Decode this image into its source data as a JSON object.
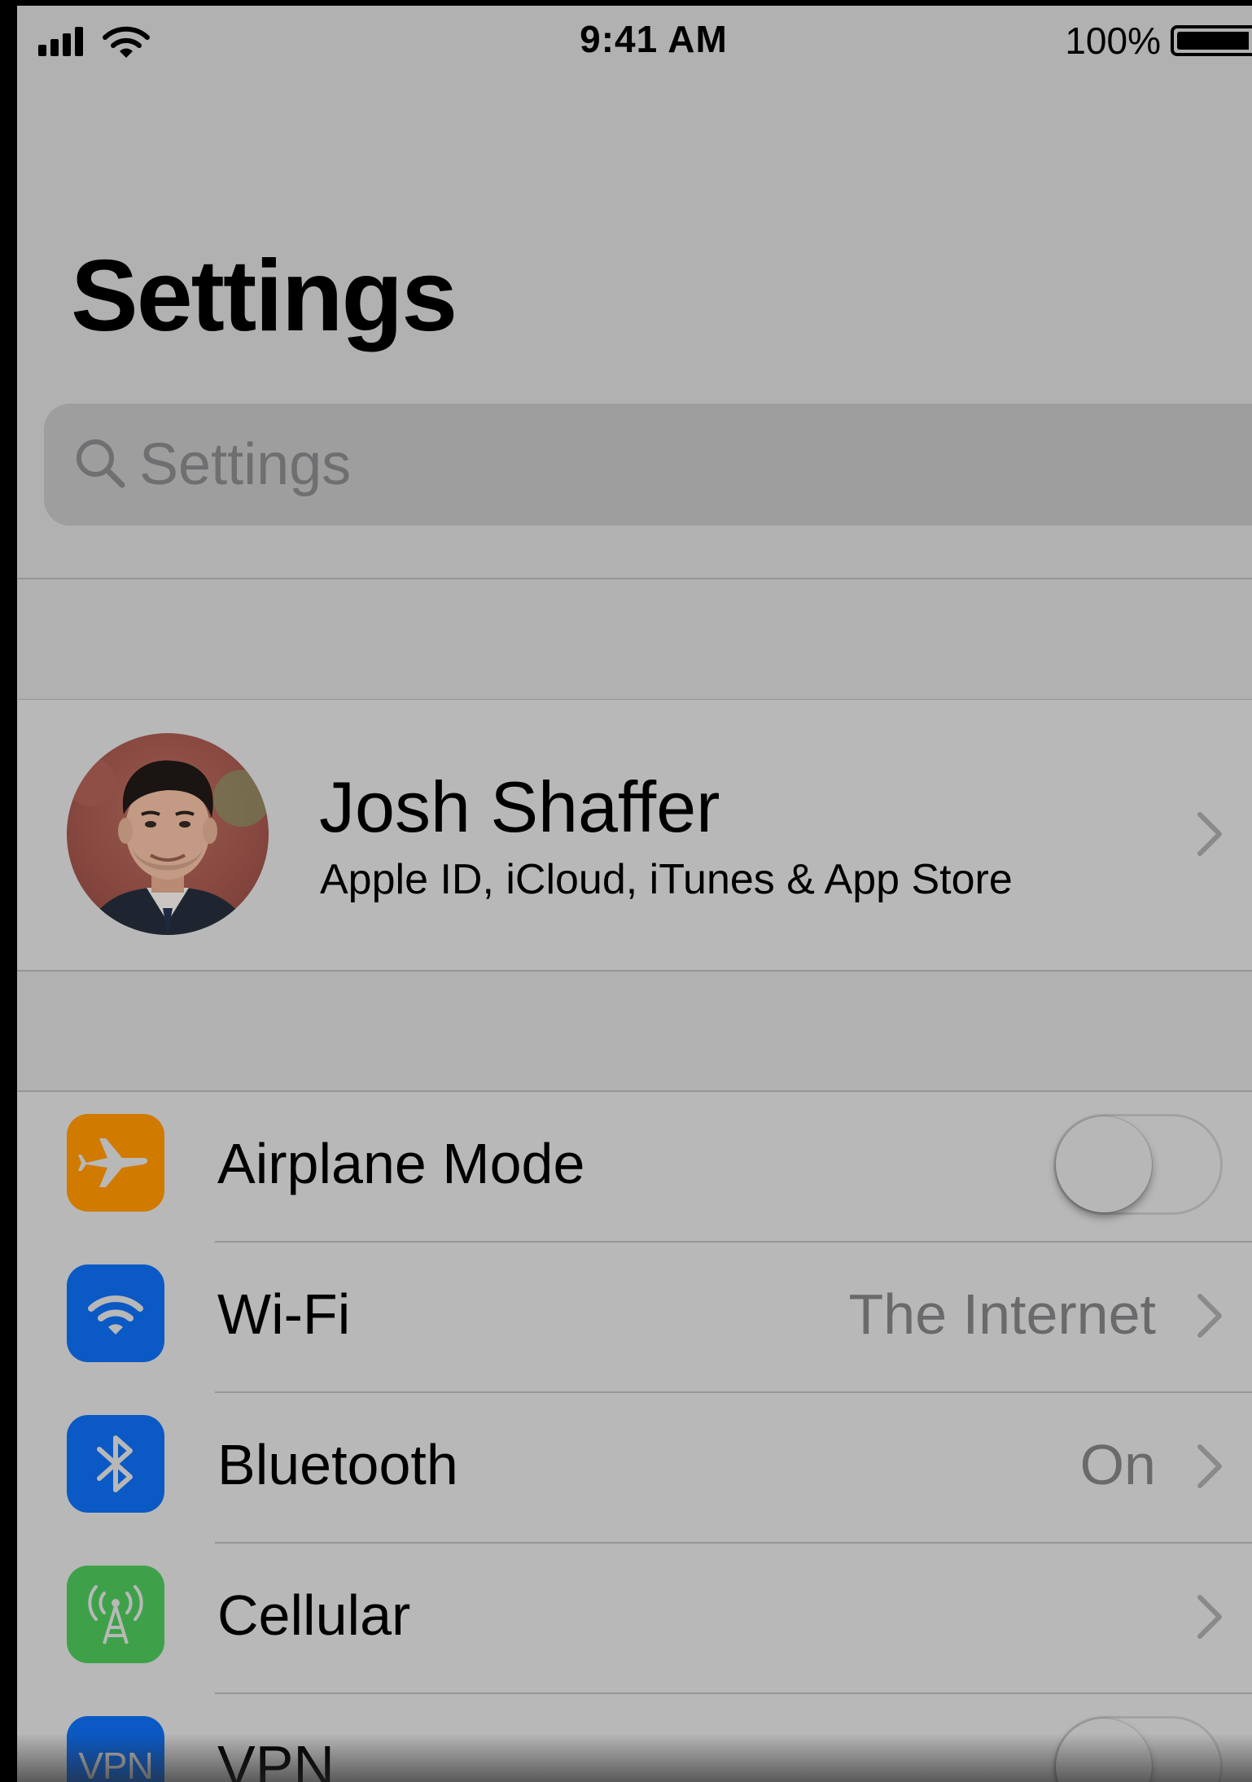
{
  "status_bar": {
    "time": "9:41 AM",
    "battery_percent": "100%",
    "battery_level": 1.0,
    "signal_icon": "signal-bars-icon",
    "wifi_icon": "wifi-icon"
  },
  "header": {
    "title": "Settings"
  },
  "search": {
    "placeholder": "Settings",
    "icon": "search-icon"
  },
  "profile": {
    "name": "Josh Shaffer",
    "subtitle": "Apple ID, iCloud, iTunes & App Store",
    "avatar_icon": "avatar-photo"
  },
  "settings": {
    "items": [
      {
        "label": "Airplane Mode",
        "icon": "airplane-icon",
        "icon_color": "#d07a00",
        "control": "toggle",
        "on": false
      },
      {
        "label": "Wi-Fi",
        "value": "The Internet",
        "icon": "wifi-icon",
        "icon_color": "#0b59c4",
        "control": "chevron"
      },
      {
        "label": "Bluetooth",
        "value": "On",
        "icon": "bluetooth-icon",
        "icon_color": "#0b59c4",
        "control": "chevron"
      },
      {
        "label": "Cellular",
        "value": "",
        "icon": "cellular-antenna-icon",
        "icon_color": "#3ea14a",
        "control": "chevron"
      },
      {
        "label": "VPN",
        "icon_text": "VPN",
        "icon": "vpn-icon",
        "icon_color": "#0b59c4",
        "control": "toggle",
        "on": false
      }
    ]
  },
  "colors": {
    "background": "#b1b1b1",
    "group_background": "#b8b8b8",
    "search_field": "#9e9e9f",
    "secondary_text": "#6a6a6d"
  }
}
